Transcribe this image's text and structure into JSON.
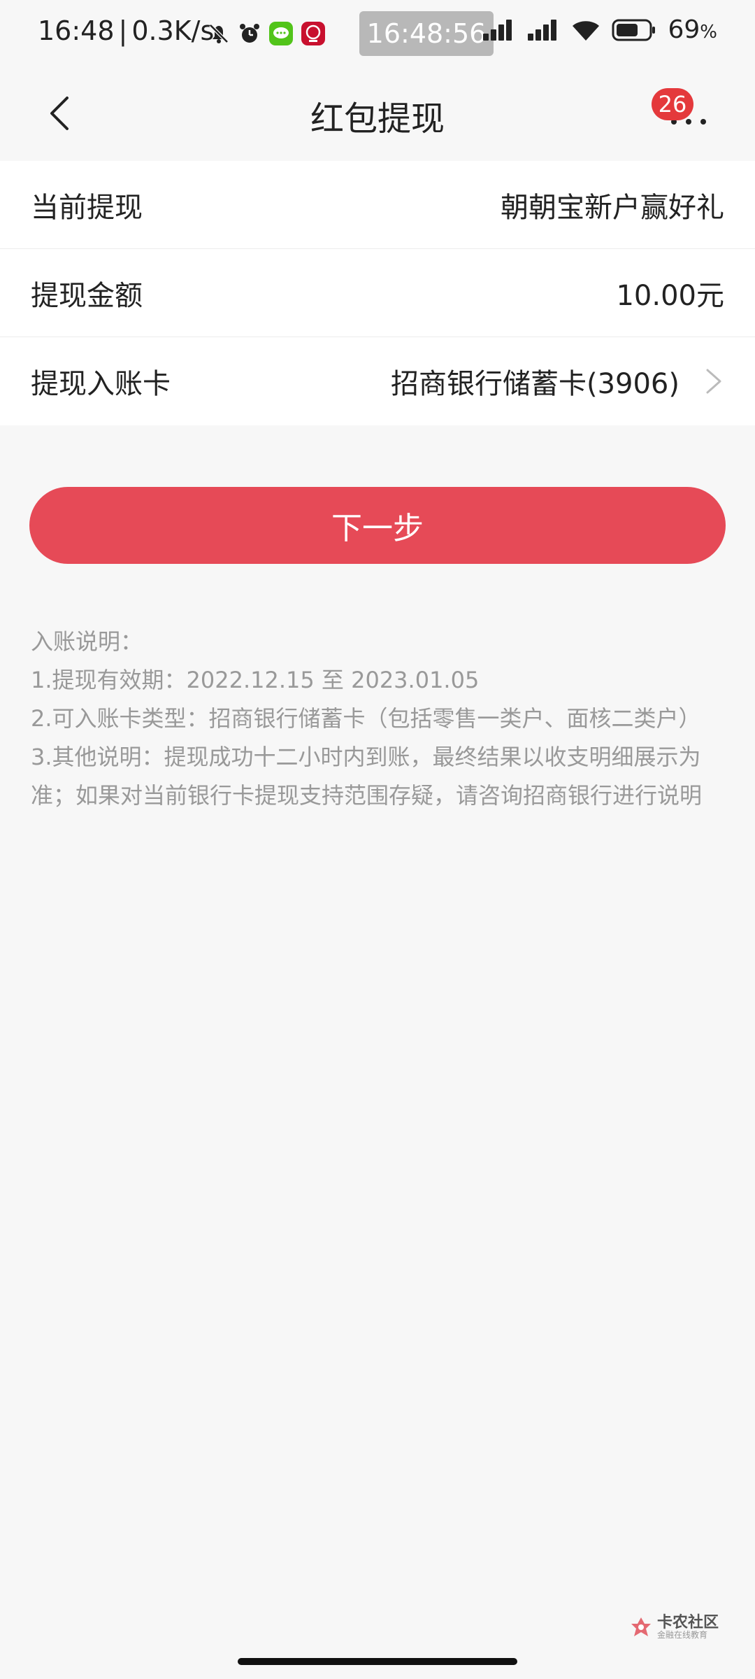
{
  "status_bar": {
    "time": "16:48",
    "separator": "|",
    "net_speed": "0.3K/s",
    "clock_pill": "16:48:56",
    "battery_pct": "69",
    "battery_unit": "%",
    "battery_level": 0.69
  },
  "nav": {
    "title": "红包提现",
    "badge_count": "26"
  },
  "info": {
    "rows": [
      {
        "label": "当前提现",
        "value": "朝朝宝新户赢好礼"
      },
      {
        "label": "提现金额",
        "value": "10.00元"
      },
      {
        "label": "提现入账卡",
        "value": "招商银行储蓄卡(3906)"
      }
    ]
  },
  "action": {
    "next_label": "下一步"
  },
  "notes": {
    "title": "入账说明：",
    "lines": [
      "1.提现有效期：2022.12.15 至 2023.01.05",
      "2.可入账卡类型：招商银行储蓄卡（包括零售一类户、面核二类户）",
      "3.其他说明：提现成功十二小时内到账，最终结果以收支明细展示为准；如果对当前银行卡提现支持范围存疑，请咨询招商银行进行说明"
    ]
  },
  "watermark": {
    "main": "卡农社区",
    "sub": "金融在线教育"
  },
  "colors": {
    "accent": "#e64a57",
    "badge": "#e4393c",
    "background": "#f7f7f7",
    "note_text": "#999999"
  }
}
